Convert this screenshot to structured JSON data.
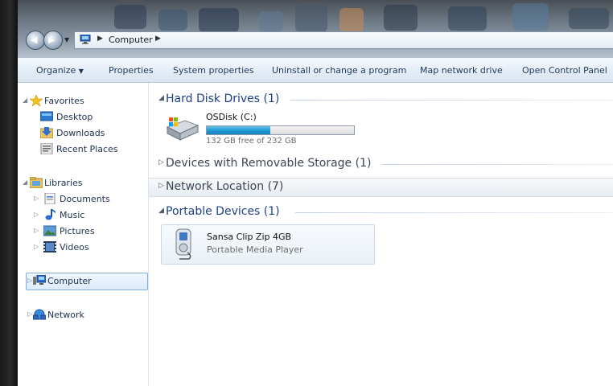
{
  "address_bar": {
    "crumbs": [
      "Computer"
    ]
  },
  "toolbar": {
    "organize": "Organize",
    "properties": "Properties",
    "system_properties": "System properties",
    "uninstall": "Uninstall or change a program",
    "map_drive": "Map network drive",
    "control_panel": "Open Control Panel"
  },
  "nav": {
    "favorites": "Favorites",
    "desktop": "Desktop",
    "downloads": "Downloads",
    "recent": "Recent Places",
    "libraries": "Libraries",
    "documents": "Documents",
    "music": "Music",
    "pictures": "Pictures",
    "videos": "Videos",
    "computer": "Computer",
    "network": "Network"
  },
  "groups": {
    "hdd": "Hard Disk Drives (1)",
    "removable": "Devices with Removable Storage (1)",
    "network": "Network Location (7)",
    "portable": "Portable Devices (1)"
  },
  "drive": {
    "name": "OSDisk (C:)",
    "free_text": "132 GB free of 232 GB",
    "used_fraction": 0.431
  },
  "device": {
    "name": "Sansa Clip Zip 4GB",
    "type": "Portable Media Player"
  }
}
